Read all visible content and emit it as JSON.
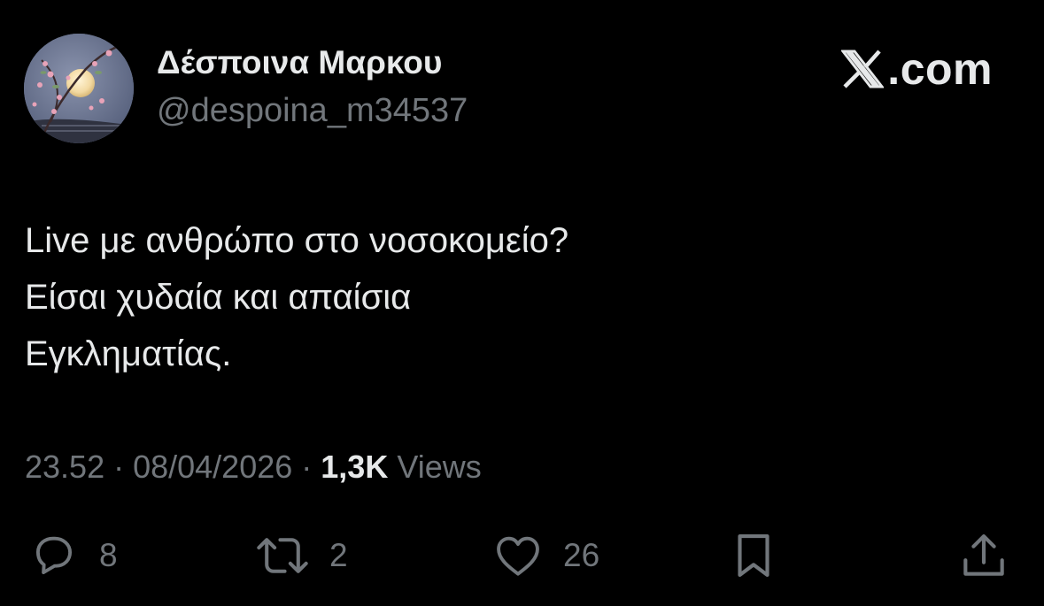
{
  "author": {
    "display_name": "Δέσποινα Μαρκου",
    "handle": "@despoina_m34537",
    "avatar_icon": "moon-blossom-avatar"
  },
  "brand": {
    "logo_icon": "x-logo-icon",
    "text": ".com"
  },
  "tweet": {
    "lines": [
      "Live με ανθρώπο στο νοσοκομείο?",
      "Είσαι χυδαία και απαίσια",
      "Εγκληματίας."
    ]
  },
  "meta": {
    "time": "23.52",
    "separator": " · ",
    "date": "08/04/2026",
    "views_count": "1,3K",
    "views_label": "Views"
  },
  "actions": {
    "replies": {
      "icon": "reply-icon",
      "count": "8"
    },
    "reposts": {
      "icon": "repost-icon",
      "count": "2"
    },
    "likes": {
      "icon": "heart-icon",
      "count": "26"
    },
    "bookmark": {
      "icon": "bookmark-icon"
    },
    "share": {
      "icon": "share-icon"
    }
  },
  "colors": {
    "background": "#000000",
    "primary_text": "#e7e9ea",
    "secondary_text": "#71767b"
  }
}
